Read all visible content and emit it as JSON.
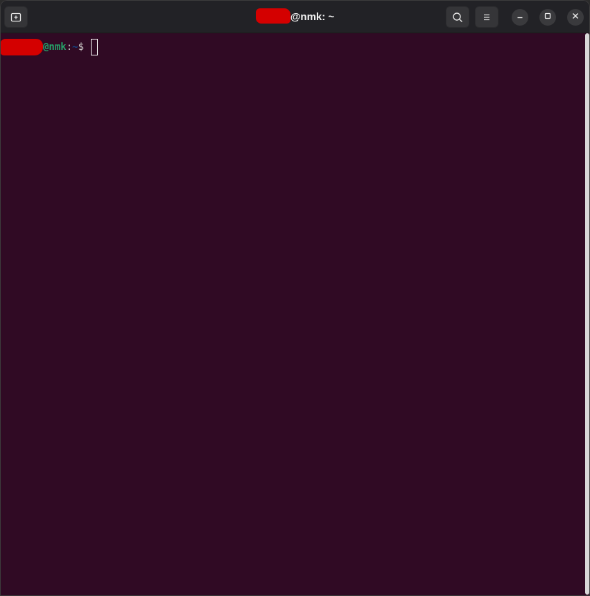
{
  "window": {
    "title_suffix": "@nmk: ~"
  },
  "headerbar": {
    "new_tab_icon": "new-tab-icon",
    "search_icon": "search-icon",
    "menu_icon": "hamburger-menu-icon",
    "minimize_icon": "minimize-icon",
    "maximize_icon": "maximize-icon",
    "close_icon": "close-icon"
  },
  "terminal": {
    "host": "@nmk",
    "separator": ":",
    "path": "~",
    "dollar": "$ ",
    "input": ""
  },
  "colors": {
    "terminal_bg": "#300a24",
    "prompt_user": "#26a269",
    "prompt_path": "#12488b",
    "redaction": "#d40000"
  }
}
